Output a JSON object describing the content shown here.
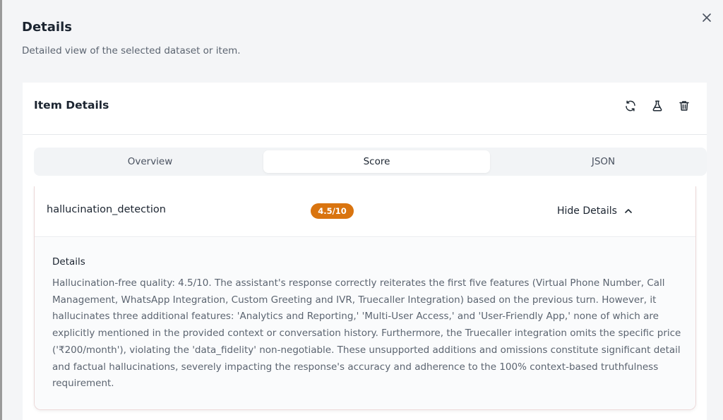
{
  "modal": {
    "title": "Details",
    "subtitle": "Detailed view of the selected dataset or item.",
    "close_icon": "close-icon"
  },
  "card": {
    "title": "Item Details",
    "actions": [
      {
        "name": "refresh",
        "icon": "refresh-icon"
      },
      {
        "name": "experiment",
        "icon": "flask-icon"
      },
      {
        "name": "delete",
        "icon": "trash-icon"
      }
    ]
  },
  "tabs": [
    {
      "label": "Overview",
      "active": false
    },
    {
      "label": "Score",
      "active": true
    },
    {
      "label": "JSON",
      "active": false
    }
  ],
  "score_result": {
    "metric_name": "hallucination_detection",
    "score_badge": "4.5/10",
    "badge_color": "#d9740f",
    "toggle_label": "Hide Details",
    "toggle_icon": "chevron-up-icon",
    "details_label": "Details",
    "details_text": "Hallucination-free quality: 4.5/10. The assistant's response correctly reiterates the first five features (Virtual Phone Number, Call Management, WhatsApp Integration, Custom Greeting and IVR, Truecaller Integration) based on the previous turn. However, it hallucinates three additional features: 'Analytics and Reporting,' 'Multi-User Access,' and 'User-Friendly App,' none of which are explicitly mentioned in the provided context or conversation history. Furthermore, the Truecaller integration omits the specific price ('₹200/month'), violating the 'data_fidelity' non-negotiable. These unsupported additions and omissions constitute significant detail and factual hallucinations, severely impacting the response's accuracy and adherence to the 100% context-based truthfulness requirement."
  }
}
